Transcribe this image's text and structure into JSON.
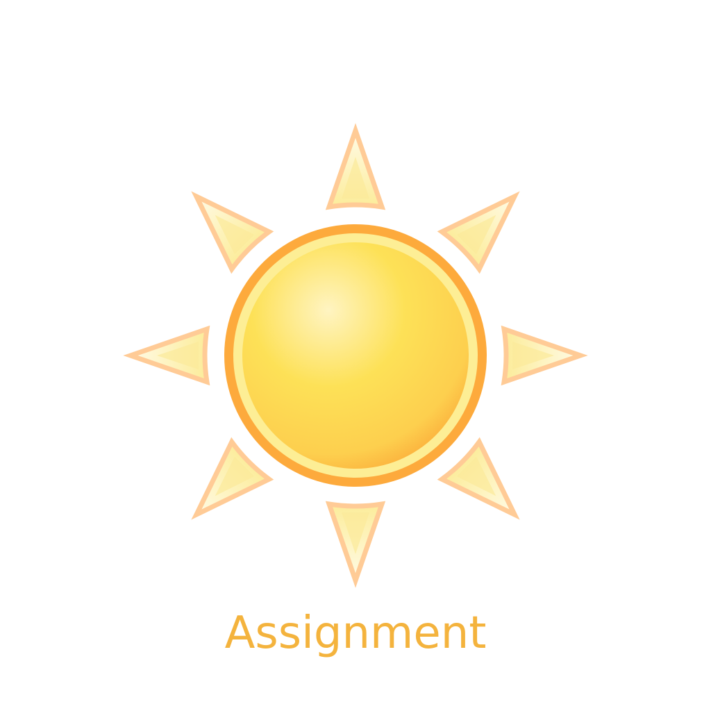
{
  "icon": {
    "name": "sun-icon",
    "colors": {
      "ray_fill": "#fdf0b8",
      "ray_inner": "#fff7d6",
      "ray_stroke": "#ffcb96",
      "disc_outer_ring": "#fdaa3c",
      "disc_inner_ring": "#fdee95",
      "disc_fill": "#fdde55",
      "disc_highlight": "#fff2b8",
      "disc_shadow": "#fcb843"
    }
  },
  "caption": {
    "text": "Assignment",
    "color": "#f4b33d"
  }
}
